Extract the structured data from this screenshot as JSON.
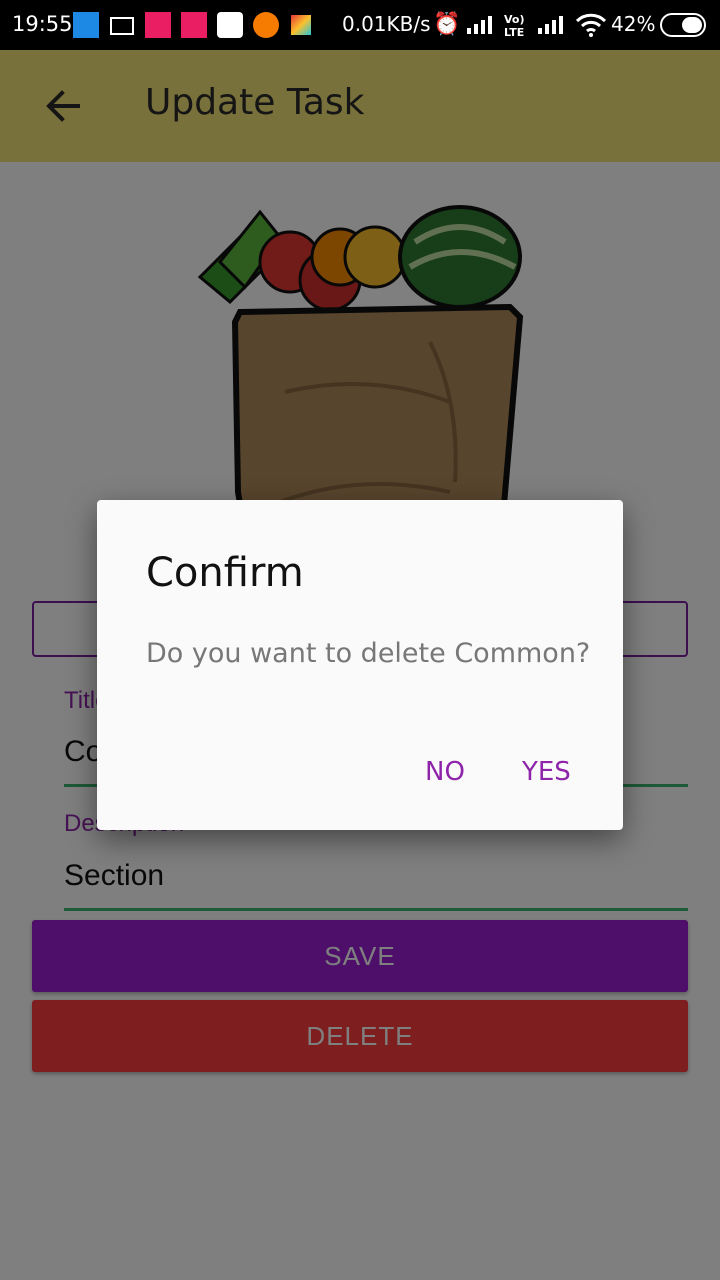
{
  "status_bar": {
    "time": "19:55",
    "net_speed": "0.01KB/s",
    "battery": "42%",
    "icons": [
      "espn-cricinfo-icon",
      "ftp-icon",
      "airtel-icon",
      "airtel-icon",
      "app-icon",
      "orange-circle-icon",
      "kite-icon",
      "alarm-icon",
      "signal-icon",
      "volte-icon",
      "signal-icon",
      "wifi-icon",
      "battery-icon"
    ]
  },
  "app_bar": {
    "title": "Update Task",
    "back_icon": "back-arrow-icon",
    "color": "#f3e276"
  },
  "form": {
    "title_label": "Title",
    "title_value": "Common",
    "description_label": "Description",
    "description_value": "Section",
    "save_label": "SAVE",
    "delete_label": "DELETE"
  },
  "dialog": {
    "title": "Confirm",
    "message": "Do you want to delete Common?",
    "no_label": "NO",
    "yes_label": "YES"
  },
  "colors": {
    "accent": "#8e24aa",
    "save": "#9c1fd6",
    "delete": "#ff3c3c",
    "underline": "#3bb56a"
  }
}
